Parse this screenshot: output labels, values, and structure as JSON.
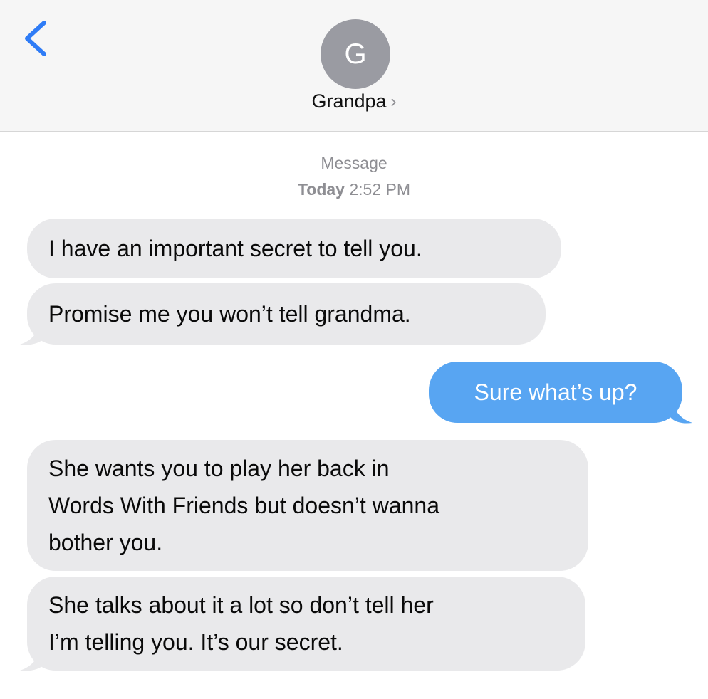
{
  "header": {
    "avatar_letter": "G",
    "contact_name": "Grandpa",
    "contact_chevron": "›"
  },
  "conversation": {
    "service_label": "Message",
    "day_label": "Today",
    "time_label": "2:52 PM"
  },
  "messages": [
    {
      "sender": "contact",
      "text": "I have an important secret to tell you."
    },
    {
      "sender": "contact",
      "text": "Promise me you won’t tell grandma."
    },
    {
      "sender": "me",
      "text": "Sure what’s up?"
    },
    {
      "sender": "contact",
      "text_lines": [
        "She wants you to play her back in",
        "Words With Friends but doesn’t wanna",
        "bother you."
      ]
    },
    {
      "sender": "contact",
      "text_lines": [
        "She talks about it a lot so don’t tell her",
        "I’m telling you. It’s our secret."
      ]
    }
  ],
  "colors": {
    "received_bubble": "#e9e9eb",
    "sent_bubble": "#58a5f2",
    "accent_blue": "#1a7cf5",
    "avatar": "#9a9ba2"
  }
}
